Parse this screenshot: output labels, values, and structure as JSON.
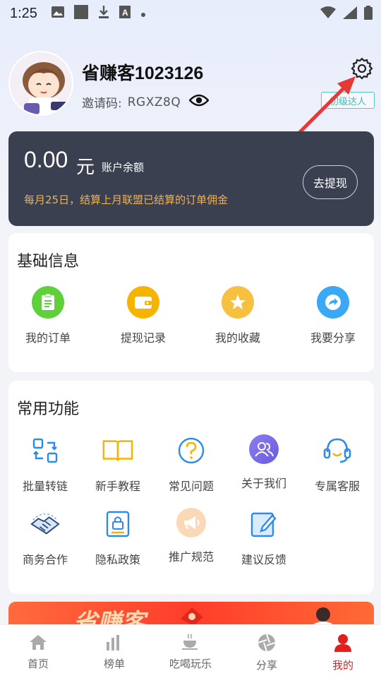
{
  "status_bar": {
    "time": "1:25"
  },
  "profile": {
    "username": "省赚客1023126",
    "invite_label": "邀请码:",
    "invite_code": "RGXZ8Q",
    "level_badge": "初级达人"
  },
  "balance": {
    "amount": "0.00",
    "unit": "元",
    "label": "账户余额",
    "note": "每月25日，结算上月联盟已结算的订单佣金",
    "withdraw_label": "去提现"
  },
  "basic_info": {
    "title": "基础信息",
    "items": [
      {
        "label": "我的订单",
        "icon": "clipboard-icon",
        "color": "#5fcf3a"
      },
      {
        "label": "提现记录",
        "icon": "wallet-icon",
        "color": "#f5b400"
      },
      {
        "label": "我的收藏",
        "icon": "star-icon",
        "color": "#f7c040"
      },
      {
        "label": "我要分享",
        "icon": "share-arrow-icon",
        "color": "#3aa8f5"
      }
    ]
  },
  "common_functions": {
    "title": "常用功能",
    "items": [
      {
        "label": "批量转链",
        "icon": "batch-convert-icon"
      },
      {
        "label": "新手教程",
        "icon": "book-icon"
      },
      {
        "label": "常见问题",
        "icon": "question-icon"
      },
      {
        "label": "关于我们",
        "icon": "people-icon"
      },
      {
        "label": "专属客服",
        "icon": "headset-icon"
      },
      {
        "label": "商务合作",
        "icon": "handshake-icon"
      },
      {
        "label": "隐私政策",
        "icon": "lock-document-icon"
      },
      {
        "label": "推广规范",
        "icon": "megaphone-icon"
      },
      {
        "label": "建议反馈",
        "icon": "edit-icon"
      }
    ]
  },
  "banner": {
    "text": "省赚客"
  },
  "tabbar": {
    "tabs": [
      {
        "label": "首页",
        "icon": "home-icon"
      },
      {
        "label": "榜单",
        "icon": "ranking-icon"
      },
      {
        "label": "吃喝玩乐",
        "icon": "coffee-icon"
      },
      {
        "label": "分享",
        "icon": "aperture-icon"
      },
      {
        "label": "我的",
        "icon": "user-icon",
        "active": true
      }
    ]
  },
  "colors": {
    "accent_red": "#e02020",
    "balance_card": "#3b4051",
    "note_gold": "#e8b15e"
  }
}
